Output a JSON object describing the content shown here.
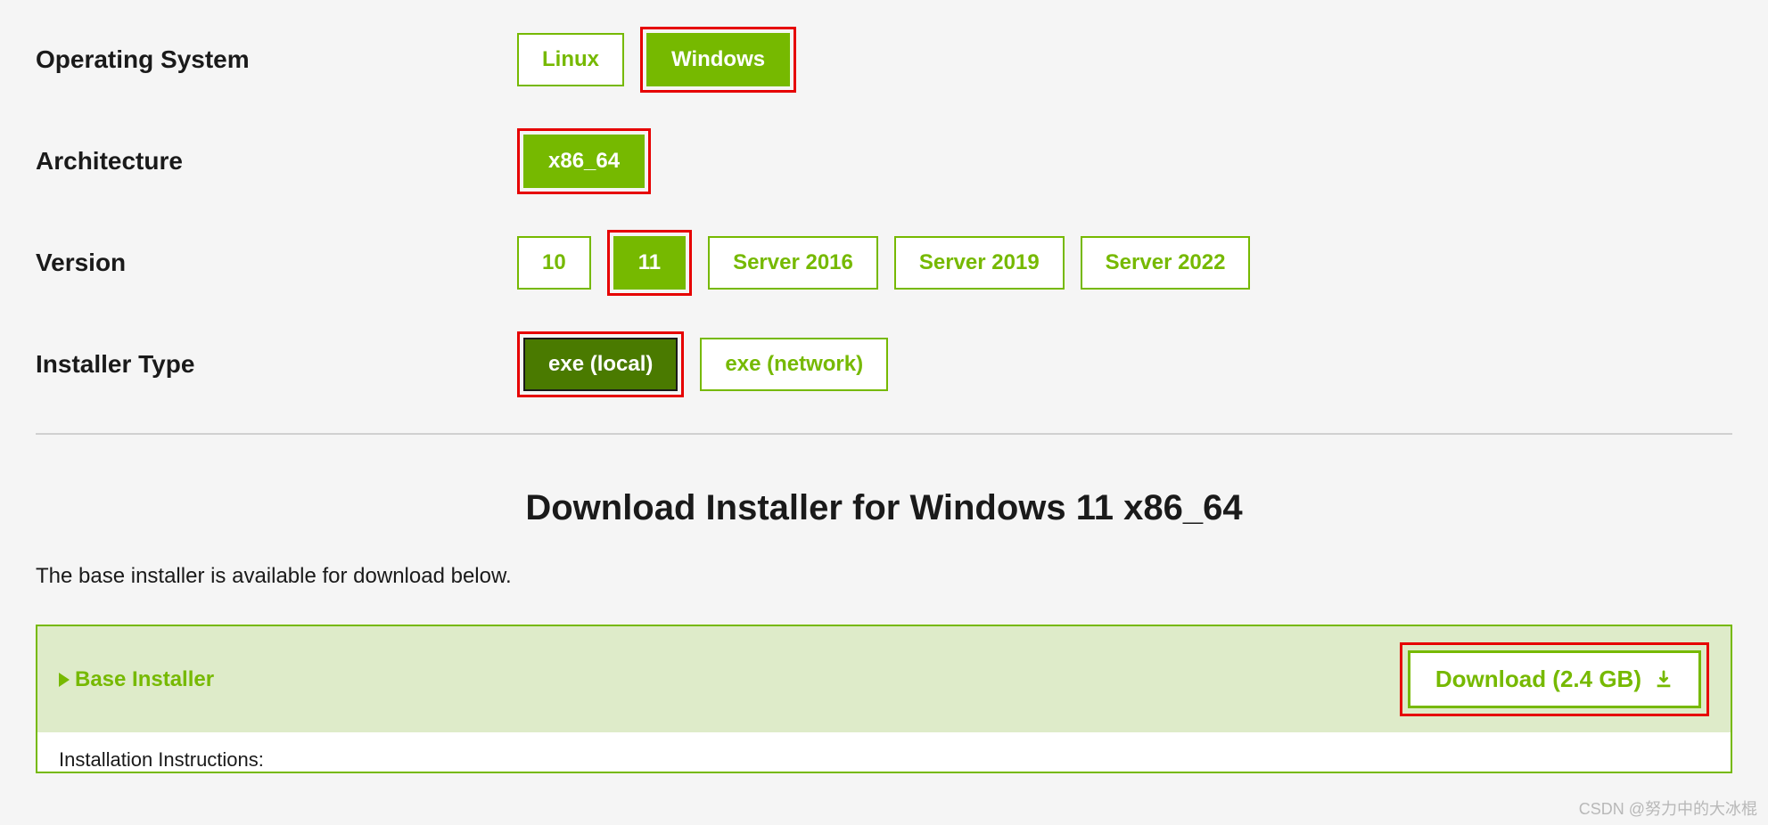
{
  "selectors": {
    "os": {
      "label": "Operating System",
      "options": [
        "Linux",
        "Windows"
      ],
      "selected": "Windows",
      "highlighted": [
        "Windows"
      ]
    },
    "arch": {
      "label": "Architecture",
      "options": [
        "x86_64"
      ],
      "selected": "x86_64",
      "highlighted": [
        "x86_64"
      ]
    },
    "version": {
      "label": "Version",
      "options": [
        "10",
        "11",
        "Server 2016",
        "Server 2019",
        "Server 2022"
      ],
      "selected": "11",
      "highlighted": [
        "11"
      ]
    },
    "installer_type": {
      "label": "Installer Type",
      "options": [
        "exe (local)",
        "exe (network)"
      ],
      "selected": "exe (local)",
      "highlighted": [
        "exe (local)"
      ],
      "dark_selected": true
    }
  },
  "download": {
    "heading": "Download Installer for Windows 11 x86_64",
    "subtext": "The base installer is available for download below.",
    "panel_title": "Base Installer",
    "button_label": "Download (2.4 GB)",
    "instructions_label": "Installation Instructions:"
  },
  "watermark": "CSDN @努力中的大冰棍"
}
